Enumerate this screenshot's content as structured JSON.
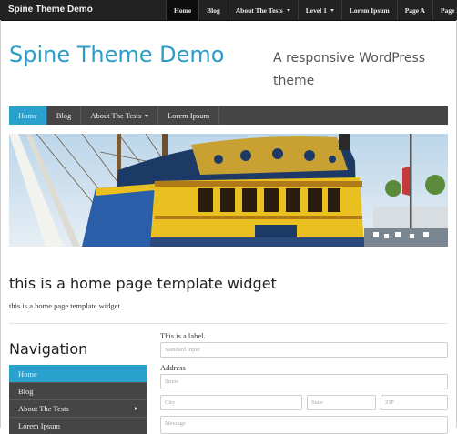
{
  "topbar": {
    "site_title": "Spine Theme Demo",
    "nav": [
      {
        "label": "Home",
        "active": true,
        "has_dropdown": false
      },
      {
        "label": "Blog",
        "active": false,
        "has_dropdown": false
      },
      {
        "label": "About The Tests",
        "active": false,
        "has_dropdown": true
      },
      {
        "label": "Level 1",
        "active": false,
        "has_dropdown": true
      },
      {
        "label": "Lorem Ipsum",
        "active": false,
        "has_dropdown": false
      },
      {
        "label": "Page A",
        "active": false,
        "has_dropdown": false
      },
      {
        "label": "Page B",
        "active": false,
        "has_dropdown": false
      }
    ]
  },
  "header": {
    "brand": "Spine Theme Demo",
    "tagline": "A responsive WordPress theme"
  },
  "mainnav": [
    {
      "label": "Home",
      "active": true,
      "has_dropdown": false
    },
    {
      "label": "Blog",
      "active": false,
      "has_dropdown": false
    },
    {
      "label": "About The Tests",
      "active": false,
      "has_dropdown": true
    },
    {
      "label": "Lorem Ipsum",
      "active": false,
      "has_dropdown": false
    }
  ],
  "hero": {
    "image_subject": "tall-ship-stern"
  },
  "widget": {
    "title": "this is a home page template widget",
    "text": "this is a home page template widget"
  },
  "sidebar": {
    "heading": "Navigation",
    "items": [
      {
        "label": "Home",
        "active": true,
        "has_children": false
      },
      {
        "label": "Blog",
        "active": false,
        "has_children": false
      },
      {
        "label": "About The Tests",
        "active": false,
        "has_children": true
      },
      {
        "label": "Lorem Ipsum",
        "active": false,
        "has_children": false
      }
    ]
  },
  "form": {
    "label": "This is a label.",
    "standard_input_placeholder": "Standard Input",
    "address_label": "Address",
    "street_placeholder": "Street",
    "city_placeholder": "City",
    "state_placeholder": "State",
    "zip_placeholder": "ZIP",
    "message_placeholder": "Message"
  },
  "colors": {
    "accent": "#2aa0cc",
    "topbar": "#222222",
    "nav": "#454545",
    "brand": "#2a9ec8"
  }
}
